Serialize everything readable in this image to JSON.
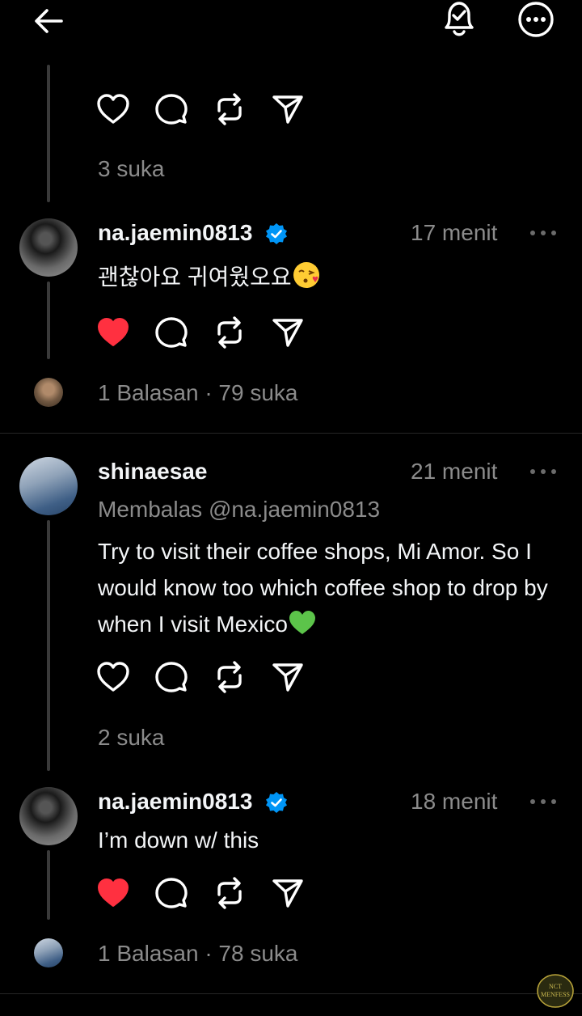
{
  "header": {
    "back_icon": "arrow-left-icon",
    "bell_icon": "bell-check-icon",
    "more_icon": "more-circle-icon"
  },
  "posts": [
    {
      "likes_text": "3 suka"
    },
    {
      "username": "na.jaemin0813",
      "verified": true,
      "time": "17 menit",
      "text": "괜찮아요 귀여웠오요",
      "emoji": "kissing-heart-emoji",
      "liked": true,
      "meta": "1 Balasan · 79 suka"
    },
    {
      "username": "shinaesae",
      "verified": false,
      "time": "21 menit",
      "reply_to": "Membalas @na.jaemin0813",
      "text": "Try to visit their coffee shops, Mi Amor. So I would know too which coffee shop to drop by when I visit Mexico",
      "emoji": "green-heart-emoji",
      "liked": false,
      "meta": "2 suka"
    },
    {
      "username": "na.jaemin0813",
      "verified": true,
      "time": "18 menit",
      "text": "I’m down w/ this",
      "liked": true,
      "meta": "1 Balasan · 78 suka"
    }
  ],
  "watermark": {
    "text": "NCT MENFESS"
  },
  "colors": {
    "background": "#000000",
    "text": "#f3f5f7",
    "muted": "#8b8b8b",
    "liked": "#ff3040",
    "verified": "#0095f6"
  }
}
